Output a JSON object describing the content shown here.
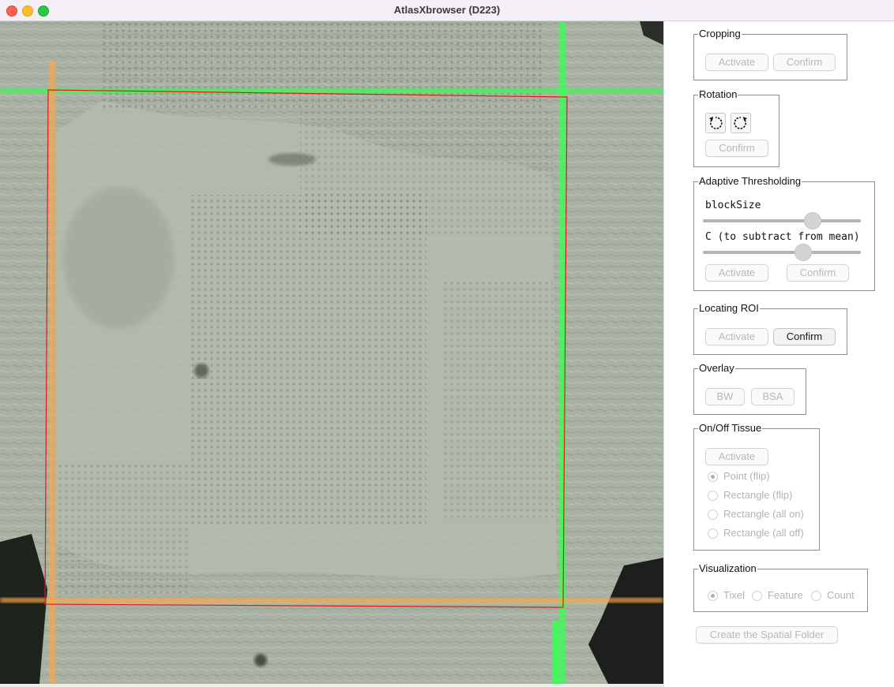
{
  "window": {
    "title": "AtlasXbrowser (D223)"
  },
  "image_viewer": {
    "description_hidden": ""
  },
  "cropping": {
    "legend": "Cropping",
    "activate_label": "Activate",
    "confirm_label": "Confirm"
  },
  "rotation": {
    "legend": "Rotation",
    "confirm_label": "Confirm",
    "ccw_icon": "rotate-ccw-icon",
    "cw_icon": "rotate-cw-icon"
  },
  "thresholding": {
    "legend": "Adaptive Thresholding",
    "blocksize_label": "blockSize",
    "blocksize_value": 0.69,
    "c_label": "C (to subtract from mean)",
    "c_value": 0.63,
    "activate_label": "Activate",
    "confirm_label": "Confirm"
  },
  "roi": {
    "legend": "Locating ROI",
    "activate_label": "Activate",
    "confirm_label": "Confirm"
  },
  "overlay": {
    "legend": "Overlay",
    "bw_label": "BW",
    "bsa_label": "BSA"
  },
  "tissue": {
    "legend": "On/Off Tissue",
    "activate_label": "Activate",
    "options": [
      "Point (flip)",
      "Rectangle (flip)",
      "Rectangle (all on)",
      "Rectangle (all off)"
    ],
    "selected": "Point (flip)"
  },
  "visualization": {
    "legend": "Visualization",
    "options": [
      "Tixel",
      "Feature",
      "Count"
    ],
    "selected": "Tixel"
  },
  "footer": {
    "create_folder_label": "Create the Spatial Folder"
  },
  "colors": {
    "roi_rect": "#e21b1b",
    "green_line": "#38ff52",
    "orange_line": "#ffb050",
    "background_image": "#a9b2a4"
  }
}
